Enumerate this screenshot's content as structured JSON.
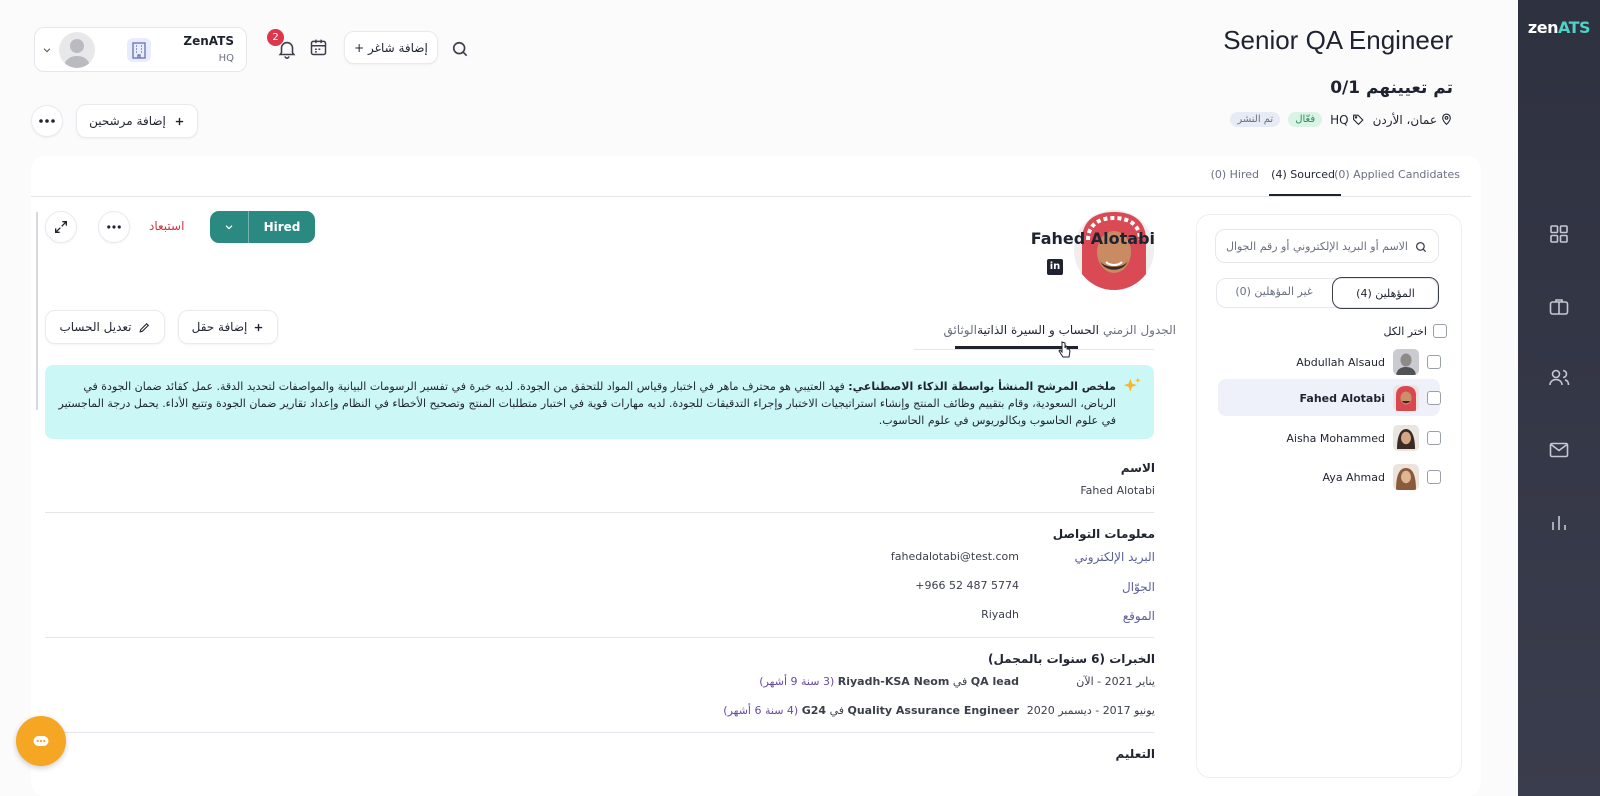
{
  "brand": {
    "logo_main": "zen",
    "logo_accent": "ATS"
  },
  "rail": {
    "icons": [
      "grid-icon",
      "briefcase-icon",
      "users-icon",
      "mail-icon",
      "chart-icon"
    ]
  },
  "header": {
    "job_title": "Senior QA Engineer",
    "hired_ratio": "0/1 تم تعيينهم",
    "location": "عمان، الأردن",
    "department": "HQ",
    "status_active": "فعّال",
    "status_published": "تم النشر",
    "add_vacancy": "+ إضافة شاغر",
    "add_candidates": "إضافة مرشحين",
    "notifications_count": "2",
    "account_name": "ZenATS",
    "account_sub": "HQ"
  },
  "pipeline_tabs": [
    {
      "label": "(0) Applied Candidates"
    },
    {
      "label": "(4) Sourced"
    },
    {
      "label": "(0) Hired"
    }
  ],
  "list": {
    "search_placeholder": "الاسم أو البريد الإلكتروني أو رقم الجوال",
    "qualified_tab": "المؤهلين (4)",
    "unqualified_tab": "غير المؤهلين (0)",
    "select_all": "اختر الكل",
    "candidates": [
      {
        "name": "Abdullah Alsaud"
      },
      {
        "name": "Fahed Alotabi"
      },
      {
        "name": "Aisha Mohammed"
      },
      {
        "name": "Aya Ahmad"
      }
    ]
  },
  "profile": {
    "name": "Fahed Alotabi",
    "stage_button": "Hired",
    "exclude": "استبعاد",
    "tabs": {
      "timeline": "الجدول الزمني",
      "profile_cv": "الحساب و السيرة الذاتية",
      "documents": "الوثائق"
    },
    "add_field": "إضافة حقل",
    "edit_profile": "تعديل الحساب",
    "ai_summary_title": "ملخص المرشح المنشأ بواسطة الذكاء الاصطناعي:",
    "ai_summary_line1": "فهد العتيبي هو محترف ماهر في اختبار وقياس المواد للتحقق من الجودة. لديه خبرة في تفسير الرسومات البيانية والمواصفات لتحديد الدقة. عمل كقائد ضمان الجودة في الرياض،",
    "ai_summary_line2": "السعودية، وقام بتقييم وظائف المنتج وإنشاء استراتيجيات الاختبار وإجراء التدقيقات للجودة. لديه مهارات قوية في اختبار متطلبات المنتج وتصحيح الأخطاء في النظام وإعداد تقارير ضمان الجودة وتتبع الأداء. يحمل درجة الماجستير في علوم",
    "ai_summary_line3": "الحاسوب وبكالوريوس في علوم الحاسوب.",
    "name_label": "الاسم",
    "name_value": "Fahed Alotabi",
    "contact_label": "معلومات التواصل",
    "email_label": "البريد الإلكتروني",
    "email_value": "fahedalotabi@test.com",
    "phone_label": "الجوّال",
    "phone_value": "+966 52 487 5774",
    "location_label": "الموقع",
    "location_value": "Riyadh",
    "experience_label": "الخبرات (6 سنوات بالمجمل)",
    "experiences": [
      {
        "period": "يناير 2021 - الآن",
        "role": "QA lead",
        "in": "في",
        "company": "Riyadh-KSA Neom",
        "duration": "(3 سنة 9 أشهر)"
      },
      {
        "period": "يونيو 2017 - ديسمبر 2020",
        "role": "Quality Assurance Engineer",
        "in": "في",
        "company": "G24",
        "duration": "(4 سنة 6 أشهر)"
      }
    ],
    "education_label": "التعليم"
  },
  "colors": {
    "teal": "#2a8a82",
    "rail": "#2e3140",
    "ai_bg": "#ccf7f7",
    "badge": "#e0364b",
    "fab": "#f5a623"
  }
}
